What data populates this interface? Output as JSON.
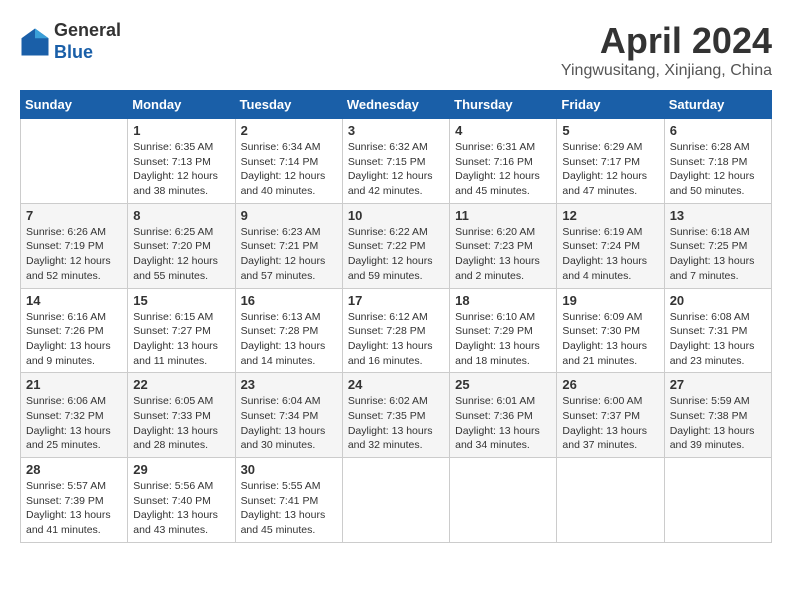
{
  "header": {
    "logo_general": "General",
    "logo_blue": "Blue",
    "month_title": "April 2024",
    "location": "Yingwusitang, Xinjiang, China"
  },
  "calendar": {
    "days_of_week": [
      "Sunday",
      "Monday",
      "Tuesday",
      "Wednesday",
      "Thursday",
      "Friday",
      "Saturday"
    ],
    "weeks": [
      [
        {
          "day": "",
          "info": ""
        },
        {
          "day": "1",
          "info": "Sunrise: 6:35 AM\nSunset: 7:13 PM\nDaylight: 12 hours\nand 38 minutes."
        },
        {
          "day": "2",
          "info": "Sunrise: 6:34 AM\nSunset: 7:14 PM\nDaylight: 12 hours\nand 40 minutes."
        },
        {
          "day": "3",
          "info": "Sunrise: 6:32 AM\nSunset: 7:15 PM\nDaylight: 12 hours\nand 42 minutes."
        },
        {
          "day": "4",
          "info": "Sunrise: 6:31 AM\nSunset: 7:16 PM\nDaylight: 12 hours\nand 45 minutes."
        },
        {
          "day": "5",
          "info": "Sunrise: 6:29 AM\nSunset: 7:17 PM\nDaylight: 12 hours\nand 47 minutes."
        },
        {
          "day": "6",
          "info": "Sunrise: 6:28 AM\nSunset: 7:18 PM\nDaylight: 12 hours\nand 50 minutes."
        }
      ],
      [
        {
          "day": "7",
          "info": "Sunrise: 6:26 AM\nSunset: 7:19 PM\nDaylight: 12 hours\nand 52 minutes."
        },
        {
          "day": "8",
          "info": "Sunrise: 6:25 AM\nSunset: 7:20 PM\nDaylight: 12 hours\nand 55 minutes."
        },
        {
          "day": "9",
          "info": "Sunrise: 6:23 AM\nSunset: 7:21 PM\nDaylight: 12 hours\nand 57 minutes."
        },
        {
          "day": "10",
          "info": "Sunrise: 6:22 AM\nSunset: 7:22 PM\nDaylight: 12 hours\nand 59 minutes."
        },
        {
          "day": "11",
          "info": "Sunrise: 6:20 AM\nSunset: 7:23 PM\nDaylight: 13 hours\nand 2 minutes."
        },
        {
          "day": "12",
          "info": "Sunrise: 6:19 AM\nSunset: 7:24 PM\nDaylight: 13 hours\nand 4 minutes."
        },
        {
          "day": "13",
          "info": "Sunrise: 6:18 AM\nSunset: 7:25 PM\nDaylight: 13 hours\nand 7 minutes."
        }
      ],
      [
        {
          "day": "14",
          "info": "Sunrise: 6:16 AM\nSunset: 7:26 PM\nDaylight: 13 hours\nand 9 minutes."
        },
        {
          "day": "15",
          "info": "Sunrise: 6:15 AM\nSunset: 7:27 PM\nDaylight: 13 hours\nand 11 minutes."
        },
        {
          "day": "16",
          "info": "Sunrise: 6:13 AM\nSunset: 7:28 PM\nDaylight: 13 hours\nand 14 minutes."
        },
        {
          "day": "17",
          "info": "Sunrise: 6:12 AM\nSunset: 7:28 PM\nDaylight: 13 hours\nand 16 minutes."
        },
        {
          "day": "18",
          "info": "Sunrise: 6:10 AM\nSunset: 7:29 PM\nDaylight: 13 hours\nand 18 minutes."
        },
        {
          "day": "19",
          "info": "Sunrise: 6:09 AM\nSunset: 7:30 PM\nDaylight: 13 hours\nand 21 minutes."
        },
        {
          "day": "20",
          "info": "Sunrise: 6:08 AM\nSunset: 7:31 PM\nDaylight: 13 hours\nand 23 minutes."
        }
      ],
      [
        {
          "day": "21",
          "info": "Sunrise: 6:06 AM\nSunset: 7:32 PM\nDaylight: 13 hours\nand 25 minutes."
        },
        {
          "day": "22",
          "info": "Sunrise: 6:05 AM\nSunset: 7:33 PM\nDaylight: 13 hours\nand 28 minutes."
        },
        {
          "day": "23",
          "info": "Sunrise: 6:04 AM\nSunset: 7:34 PM\nDaylight: 13 hours\nand 30 minutes."
        },
        {
          "day": "24",
          "info": "Sunrise: 6:02 AM\nSunset: 7:35 PM\nDaylight: 13 hours\nand 32 minutes."
        },
        {
          "day": "25",
          "info": "Sunrise: 6:01 AM\nSunset: 7:36 PM\nDaylight: 13 hours\nand 34 minutes."
        },
        {
          "day": "26",
          "info": "Sunrise: 6:00 AM\nSunset: 7:37 PM\nDaylight: 13 hours\nand 37 minutes."
        },
        {
          "day": "27",
          "info": "Sunrise: 5:59 AM\nSunset: 7:38 PM\nDaylight: 13 hours\nand 39 minutes."
        }
      ],
      [
        {
          "day": "28",
          "info": "Sunrise: 5:57 AM\nSunset: 7:39 PM\nDaylight: 13 hours\nand 41 minutes."
        },
        {
          "day": "29",
          "info": "Sunrise: 5:56 AM\nSunset: 7:40 PM\nDaylight: 13 hours\nand 43 minutes."
        },
        {
          "day": "30",
          "info": "Sunrise: 5:55 AM\nSunset: 7:41 PM\nDaylight: 13 hours\nand 45 minutes."
        },
        {
          "day": "",
          "info": ""
        },
        {
          "day": "",
          "info": ""
        },
        {
          "day": "",
          "info": ""
        },
        {
          "day": "",
          "info": ""
        }
      ]
    ]
  }
}
